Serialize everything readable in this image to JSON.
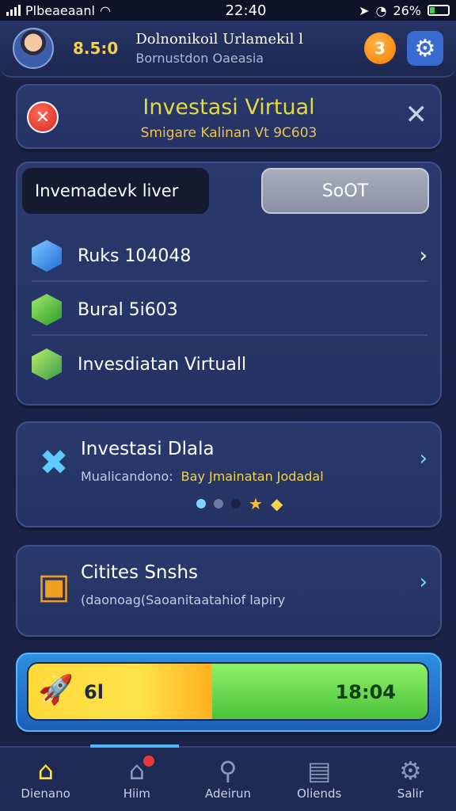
{
  "status_bar": {
    "carrier": "Plbeaeaanl",
    "time": "22:40",
    "battery": "26%",
    "battery_level": 0.26
  },
  "header": {
    "score": "8.5:0",
    "title": "Dolnonikoil Urlamekil l",
    "subtitle": "Bornustdon Oaeasia",
    "coin_badge": "3"
  },
  "title_panel": {
    "title": "Investasi Virtual",
    "subtitle": "Smigare Kalinan Vt 9C603"
  },
  "invest_panel": {
    "tab_active": "Invemadevk liver",
    "tab_secondary": "SoOT",
    "rows": [
      {
        "label": "Ruks 104048"
      },
      {
        "label": "Bural 5i603"
      },
      {
        "label": "Invesdiatan Virtuall"
      }
    ]
  },
  "cards": [
    {
      "title": "Investasi Dlala",
      "subtitle": "Mualicandono:",
      "highlight": "Bay Jmainatan Jodadal"
    },
    {
      "title": "Citites Snshs",
      "subtitle": "(daonoag(Saoanitaatahiof lapiry"
    }
  ],
  "progress": {
    "left_value": "6l",
    "right_value": "18:04",
    "fill_fraction": 0.46
  },
  "nav": [
    {
      "label": "Dienano",
      "icon": "home-icon"
    },
    {
      "label": "Hiim",
      "icon": "house-badge-icon"
    },
    {
      "label": "Adeirun",
      "icon": "search-icon"
    },
    {
      "label": "Oliends",
      "icon": "bag-icon"
    },
    {
      "label": "Salir",
      "icon": "gear-icon"
    }
  ],
  "colors": {
    "background": "#1a2247",
    "accent_gold": "#e6d93a",
    "accent_blue": "#4cb8ff"
  }
}
